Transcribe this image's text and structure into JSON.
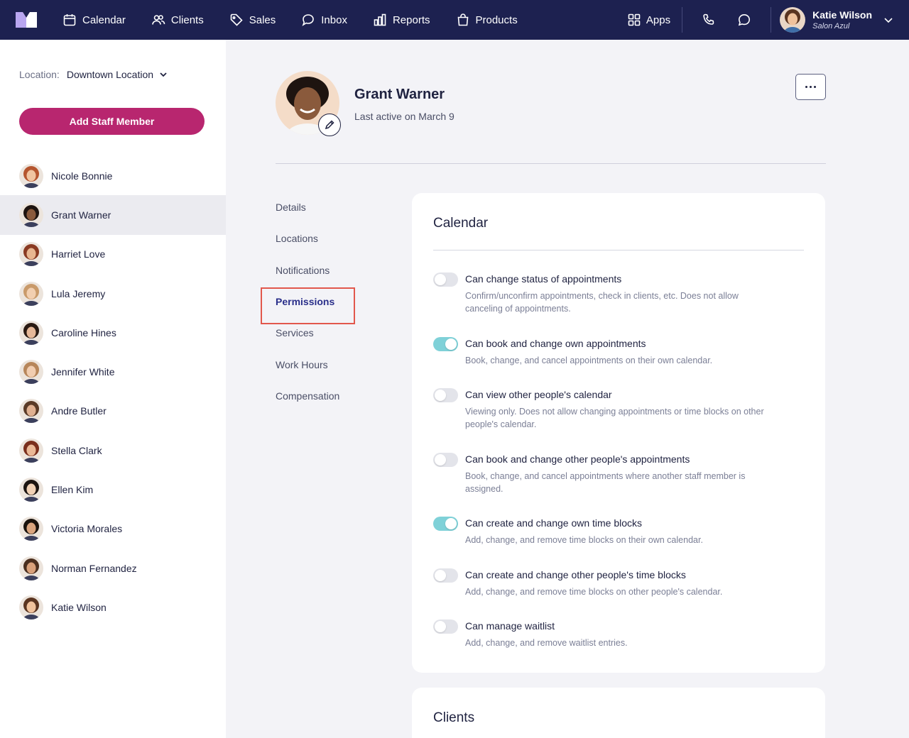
{
  "nav": {
    "items": [
      {
        "label": "Calendar",
        "icon": "calendar-icon"
      },
      {
        "label": "Clients",
        "icon": "users-icon"
      },
      {
        "label": "Sales",
        "icon": "tag-icon"
      },
      {
        "label": "Inbox",
        "icon": "chat-icon"
      },
      {
        "label": "Reports",
        "icon": "chart-icon"
      },
      {
        "label": "Products",
        "icon": "bag-icon"
      }
    ],
    "apps_label": "Apps",
    "user": {
      "name": "Katie Wilson",
      "salon": "Salon Azul"
    }
  },
  "sidebar": {
    "location_label": "Location:",
    "location_value": "Downtown Location",
    "add_button": "Add Staff Member",
    "staff": [
      {
        "name": "Nicole Bonnie",
        "skin": "#f0c4a0",
        "hair": "#b5552e"
      },
      {
        "name": "Grant Warner",
        "skin": "#8a5a3c",
        "hair": "#1e1410"
      },
      {
        "name": "Harriet Love",
        "skin": "#e8b690",
        "hair": "#8a3a22"
      },
      {
        "name": "Lula Jeremy",
        "skin": "#f2cfb0",
        "hair": "#c99a6a"
      },
      {
        "name": "Caroline Hines",
        "skin": "#e6b898",
        "hair": "#2a1a12"
      },
      {
        "name": "Jennifer White",
        "skin": "#f1cdb0",
        "hair": "#b7865a"
      },
      {
        "name": "Andre Butler",
        "skin": "#e0b090",
        "hair": "#5a3a26"
      },
      {
        "name": "Stella Clark",
        "skin": "#eab896",
        "hair": "#7a2e1c"
      },
      {
        "name": "Ellen Kim",
        "skin": "#f0d0b4",
        "hair": "#1c1410"
      },
      {
        "name": "Victoria Morales",
        "skin": "#d9a47e",
        "hair": "#1a120c"
      },
      {
        "name": "Norman Fernandez",
        "skin": "#d8a07a",
        "hair": "#4a2e1e"
      },
      {
        "name": "Katie Wilson",
        "skin": "#f0c29c",
        "hair": "#5a3420"
      }
    ]
  },
  "profile": {
    "name": "Grant Warner",
    "last_active": "Last active on March 9"
  },
  "subnav": [
    "Details",
    "Locations",
    "Notifications",
    "Permissions",
    "Services",
    "Work Hours",
    "Compensation"
  ],
  "calendar_card": {
    "title": "Calendar",
    "permissions": [
      {
        "title": "Can change status of appointments",
        "desc": "Confirm/unconfirm appointments, check in clients, etc. Does not allow canceling of appointments.",
        "on": false
      },
      {
        "title": "Can book and change own appointments",
        "desc": "Book, change, and cancel appointments on their own calendar.",
        "on": true
      },
      {
        "title": "Can view other people's calendar",
        "desc": "Viewing only. Does not allow changing appointments or time blocks on other people's calendar.",
        "on": false
      },
      {
        "title": "Can book and change other people's appointments",
        "desc": "Book, change, and cancel appointments where another staff member is assigned.",
        "on": false
      },
      {
        "title": "Can create and change own time blocks",
        "desc": "Add, change, and remove time blocks on their own calendar.",
        "on": true
      },
      {
        "title": "Can create and change other people's time blocks",
        "desc": "Add, change, and remove time blocks on other people's calendar.",
        "on": false
      },
      {
        "title": "Can manage waitlist",
        "desc": "Add, change, and remove waitlist entries.",
        "on": false
      }
    ]
  },
  "clients_card": {
    "title": "Clients"
  },
  "colors": {
    "nav_bg": "#1d2150",
    "primary_button": "#b8266f",
    "toggle_on": "#7fd1d8",
    "highlight": "#e2574c"
  }
}
